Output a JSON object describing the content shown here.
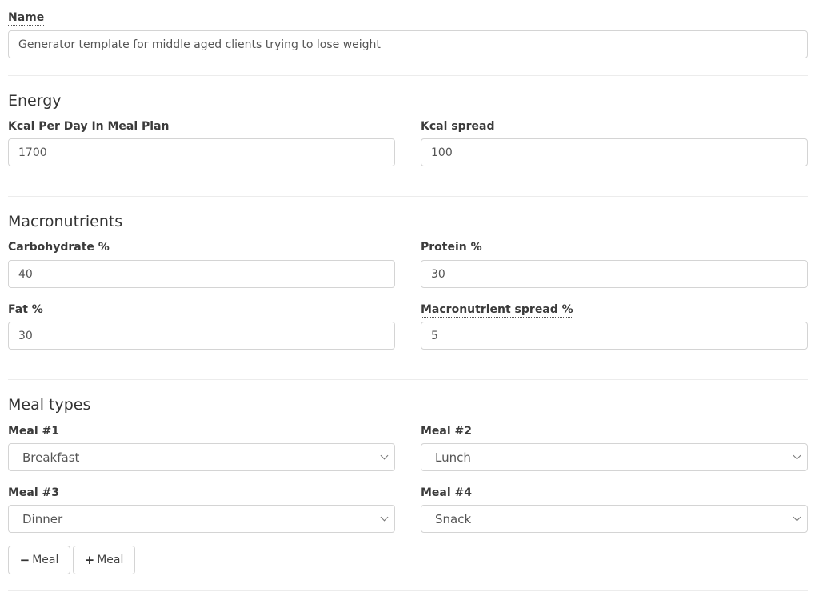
{
  "name": {
    "label": "Name",
    "value": "Generator template for middle aged clients trying to lose weight"
  },
  "energy": {
    "title": "Energy",
    "kcal_per_day": {
      "label": "Kcal Per Day In Meal Plan",
      "value": "1700"
    },
    "kcal_spread": {
      "label": "Kcal spread",
      "value": "100"
    }
  },
  "macros": {
    "title": "Macronutrients",
    "carbohydrate": {
      "label": "Carbohydrate %",
      "value": "40"
    },
    "protein": {
      "label": "Protein %",
      "value": "30"
    },
    "fat": {
      "label": "Fat %",
      "value": "30"
    },
    "spread": {
      "label": "Macronutrient spread %",
      "value": "5"
    }
  },
  "meals": {
    "title": "Meal types",
    "items": [
      {
        "label": "Meal #1",
        "value": "Breakfast"
      },
      {
        "label": "Meal #2",
        "value": "Lunch"
      },
      {
        "label": "Meal #3",
        "value": "Dinner"
      },
      {
        "label": "Meal #4",
        "value": "Snack"
      }
    ],
    "remove_button": {
      "icon": "minus-icon",
      "glyph": "−",
      "label": "Meal"
    },
    "add_button": {
      "icon": "plus-icon",
      "glyph": "+",
      "label": "Meal"
    }
  }
}
